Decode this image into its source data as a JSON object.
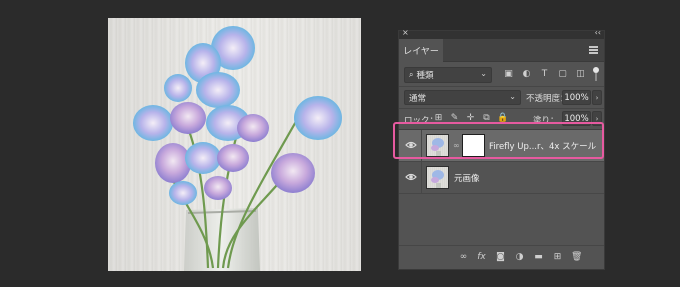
{
  "panel": {
    "close_glyph": "×",
    "collapse_glyph": "‹‹",
    "tab_label": "レイヤー",
    "menu_icon": "panel-menu-icon"
  },
  "filter": {
    "kind_label": "種類",
    "chevron": "⌄",
    "icons": [
      "pixel-filter-icon",
      "adjustment-filter-icon",
      "type-filter-icon",
      "shape-filter-icon",
      "smart-object-filter-icon"
    ],
    "glyphs": [
      "▣",
      "◐",
      "T",
      "▢",
      "◫"
    ]
  },
  "blend": {
    "mode": "通常",
    "chevron": "⌄",
    "opacity_label": "不透明度：",
    "opacity_value": "100%",
    "opacity_chevron": "›"
  },
  "lock": {
    "label": "ロック：",
    "icon_glyphs": [
      "⊞",
      "✎",
      "✛",
      "⧉",
      "🔒"
    ],
    "fill_label": "塗り：",
    "fill_value": "100%",
    "fill_chevron": "›"
  },
  "layers": [
    {
      "name": "Firefly Up...r、4x スケール",
      "selected": true,
      "has_mask": true,
      "chain_glyph": "∞"
    },
    {
      "name": "元画像",
      "selected": false,
      "has_mask": false
    }
  ],
  "footer": {
    "glyphs": [
      "∞",
      "fx",
      "◙",
      "◑",
      "▬",
      "⊞",
      "🗑"
    ]
  },
  "colors": {
    "background": "#2b2b2b",
    "panel": "#535353",
    "selected_layer": "#6a6a6a",
    "highlight": "#e65aa0"
  }
}
